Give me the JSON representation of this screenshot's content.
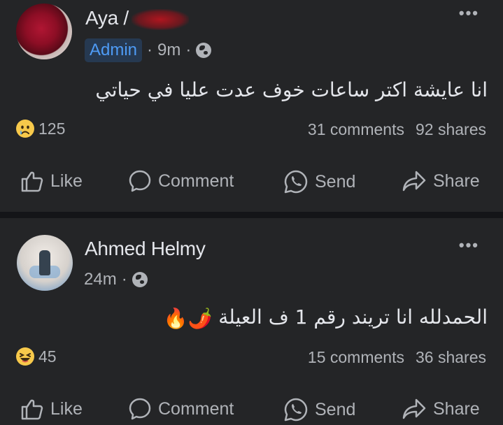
{
  "posts": [
    {
      "author": "Aya",
      "author_suffix": "/",
      "badge": "Admin",
      "time": "9m",
      "separator": "·",
      "privacy_icon": "globe-icon",
      "text": "انا عايشة اكتر ساعات خوف عدت عليا في حياتي",
      "emojis": "",
      "reaction_icon": "sad-reaction-icon",
      "reaction_count": "125",
      "comments": "31 comments",
      "shares": "92 shares"
    },
    {
      "author": "Ahmed Helmy",
      "time": "24m",
      "separator": "·",
      "privacy_icon": "globe-icon",
      "text": "الحمدلله انا تريند رقم 1 ف العيلة",
      "emojis": "🌶️🔥",
      "reaction_icon": "haha-reaction-icon",
      "reaction_count": "45",
      "comments": "15 comments",
      "shares": "36 shares"
    }
  ],
  "more_icon": "•••",
  "actions": {
    "like": "Like",
    "comment": "Comment",
    "send": "Send",
    "share": "Share"
  },
  "colors": {
    "background": "#242527",
    "separator": "#141518",
    "primary_text": "#e4e6eb",
    "secondary_text": "#b0b3b8",
    "badge_bg": "#263951",
    "badge_text": "#4e9bf5",
    "reaction_yellow": "#f7c94b"
  }
}
